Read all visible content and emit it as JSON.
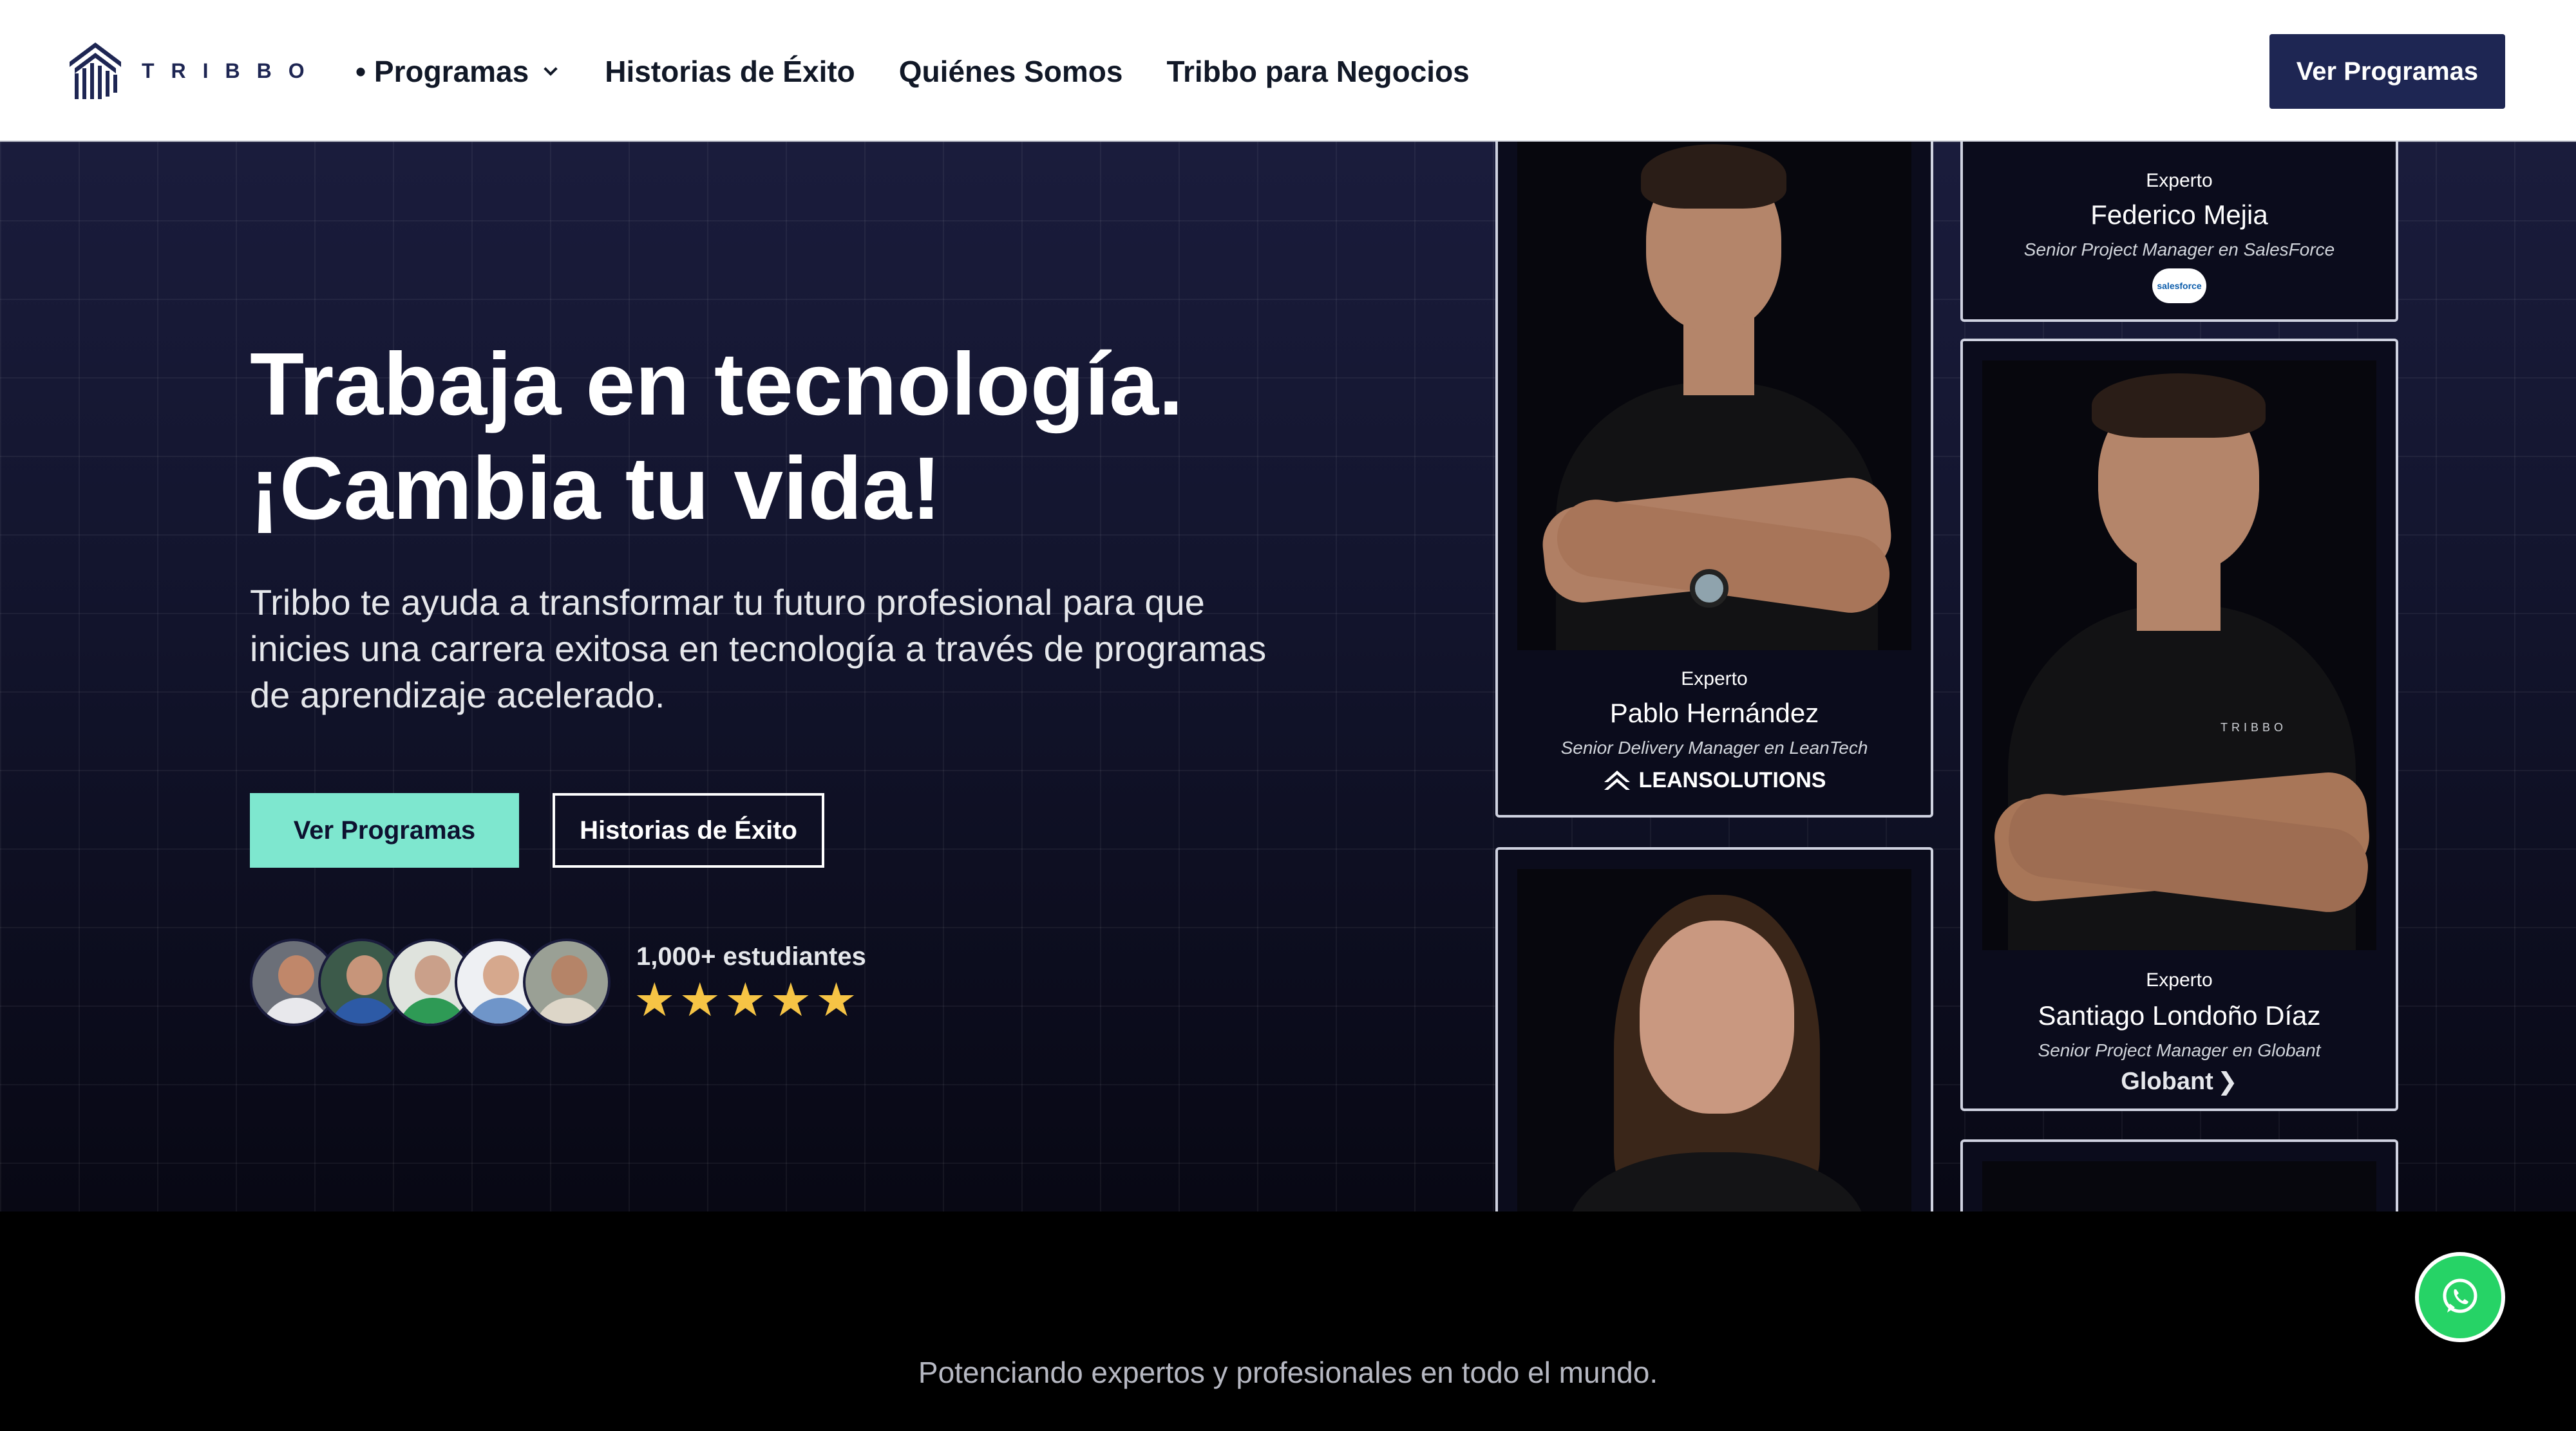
{
  "nav": {
    "brand": "TRIBBO",
    "links": [
      "• Programas",
      "Historias de Éxito",
      "Quiénes Somos",
      "Tribbo para Negocios"
    ],
    "cta": "Ver Programas"
  },
  "hero": {
    "title_line1": "Trabaja en tecnología.",
    "title_line2": "¡Cambia tu vida!",
    "subtitle": "Tribbo te ayuda a transformar tu futuro profesional para que inicies una carrera exitosa en tecnología a través de programas de aprendizaje acelerado.",
    "primary_button": "Ver Programas",
    "secondary_button": "Historias de Éxito",
    "students": "1,000+ estudiantes",
    "rating": 5
  },
  "experts": [
    {
      "label": "Experto",
      "name": "Federico Mejia",
      "role": "Senior Project Manager en SalesForce",
      "company": "salesforce"
    },
    {
      "label": "Experto",
      "name": "Pablo Hernández",
      "role": "Senior Delivery Manager en LeanTech",
      "company": "LEANSOLUTIONS"
    },
    {
      "label": "Experto",
      "name": "Santiago Londoño Díaz",
      "role": "Senior Project Manager en Globant",
      "company": "Globant"
    }
  ],
  "footer": {
    "tagline": "Potenciando expertos y profesionales en todo el mundo."
  },
  "icons": [
    "tribbo-logo-icon",
    "chevron-down-icon",
    "star-icon",
    "whatsapp-icon"
  ],
  "colors": {
    "brand_navy": "#1e2653",
    "accent_mint": "#7ee7cf",
    "star": "#f6c445",
    "whatsapp": "#26d366"
  }
}
